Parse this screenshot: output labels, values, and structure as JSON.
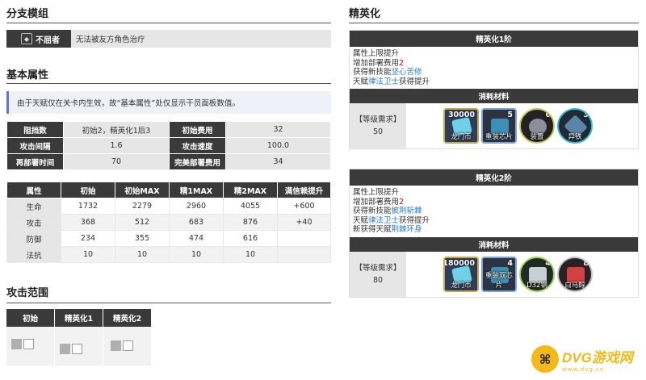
{
  "left": {
    "branch_title": "分支模组",
    "branch": {
      "name": "不屈者",
      "desc": "无法被友方角色治疗"
    },
    "basic_title": "基本属性",
    "note": "由于天赋仅在关卡内生效，故“基本属性”处仅显示干员面板数值。",
    "attrs": [
      {
        "k1": "阻挡数",
        "v1": "初始2，精英化1后3",
        "k2": "初始费用",
        "v2": "32"
      },
      {
        "k1": "攻击间隔",
        "v1": "1.6",
        "k2": "攻击速度",
        "v2": "100.0"
      },
      {
        "k1": "再部署时间",
        "v1": "70",
        "k2": "完美部署费用",
        "v2": "34"
      }
    ],
    "stats_headers": [
      "属性",
      "初始",
      "初始MAX",
      "精1MAX",
      "精2MAX",
      "满信赖提升"
    ],
    "stats_rows": [
      [
        "生命",
        "1732",
        "2279",
        "2960",
        "4055",
        "+600"
      ],
      [
        "攻击",
        "368",
        "512",
        "683",
        "876",
        "+40"
      ],
      [
        "防御",
        "234",
        "355",
        "474",
        "616",
        ""
      ],
      [
        "法抗",
        "10",
        "10",
        "10",
        "10",
        ""
      ]
    ],
    "range_title": "攻击范围",
    "range_headers": [
      "初始",
      "精英化1",
      "精英化2"
    ]
  },
  "right": {
    "title": "精英化",
    "e1": {
      "head": "精英化1阶",
      "l1": "属性上限提升",
      "l2_pre": "增加部署费用",
      "l2_val": "2",
      "l3_pre": "获得新技能",
      "l3_link": "坚心苦修",
      "l4_pre": "天赋",
      "l4_link": "律法卫士",
      "l4_post": "获得提升",
      "cost_head": "消耗材料",
      "req_label": "【等级需求】",
      "req_val": "50",
      "mats": [
        {
          "num": "30000",
          "name": "龙门币"
        },
        {
          "num": "5",
          "name": "重装芯片"
        },
        {
          "num": "6",
          "name": "装置"
        },
        {
          "num": "3",
          "name": "异铁"
        }
      ]
    },
    "e2": {
      "head": "精英化2阶",
      "l1": "属性上限提升",
      "l2_pre": "增加部署费用",
      "l2_val": "2",
      "l3_pre": "获得新技能",
      "l3_link": "披荆斩棘",
      "l4_pre": "天赋",
      "l4_link": "律法卫士",
      "l4_post": "获得提升",
      "l5_pre": "新获得天赋",
      "l5_link": "荆棘环身",
      "cost_head": "消耗材料",
      "req_label": "【等级需求】",
      "req_val": "80",
      "mats": [
        {
          "num": "180000",
          "name": "龙门币"
        },
        {
          "num": "4",
          "name": "重装双芯片"
        },
        {
          "num": "4",
          "name": "D32钢"
        },
        {
          "num": "8",
          "name": "白马醇"
        }
      ]
    }
  },
  "logo": {
    "text": "DVG游戏网",
    "sub": "www.dvg.cn"
  },
  "colors": {
    "header": "#3a3a3a",
    "link": "#2b7bd6",
    "red": "#d00000",
    "note_bar": "#5b7bc4",
    "logo": "#f3b919"
  }
}
